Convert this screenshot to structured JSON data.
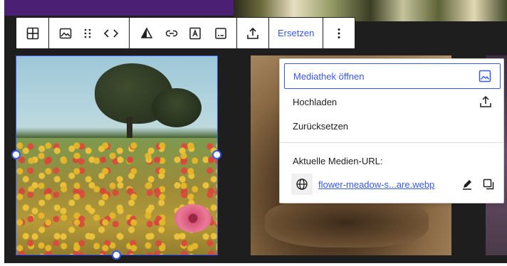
{
  "toolbar": {
    "replace_label": "Ersetzen"
  },
  "menu": {
    "items": [
      {
        "label": "Mediathek öffnen",
        "icon": "media-library-icon"
      },
      {
        "label": "Hochladen",
        "icon": "upload-icon"
      },
      {
        "label": "Zurücksetzen",
        "icon": ""
      }
    ],
    "current_url_label": "Aktuelle Medien-URL:",
    "current_url_text": "flower-meadow-s...are.webp"
  },
  "colors": {
    "accent": "#3858e9",
    "dark": "#1e1e1e",
    "purple": "#4b1f73"
  }
}
